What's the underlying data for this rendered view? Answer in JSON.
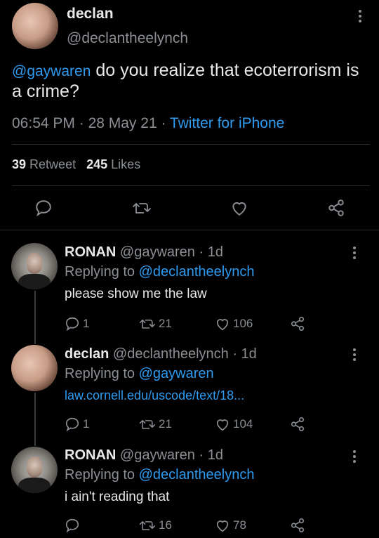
{
  "main_tweet": {
    "display_name": "declan",
    "handle": "@declantheelynch",
    "mention": "@gaywaren",
    "text_line1": " do you realize that ecoterrorism is",
    "text_line2": "a crime?",
    "time": "06:54 PM",
    "sep1": " · ",
    "date": "28 May 21",
    "sep2": " · ",
    "client": "Twitter for iPhone",
    "retweet_count": "39",
    "retweet_label": "Retweet",
    "like_count": "245",
    "like_label": "Likes"
  },
  "replies": [
    {
      "display_name": "RONAN",
      "handle_time": "@gaywaren · 1d",
      "replying_prefix": "Replying to ",
      "replying_to": "@declantheelynch",
      "text": "please show me the law",
      "reply_count": "1",
      "retweet_count": "21",
      "like_count": "106"
    },
    {
      "display_name": "declan",
      "handle_time": "@declantheelynch · 1d",
      "replying_prefix": "Replying to ",
      "replying_to": "@gaywaren",
      "link": "law.cornell.edu/uscode/text/18...",
      "reply_count": "1",
      "retweet_count": "21",
      "like_count": "104"
    },
    {
      "display_name": "RONAN",
      "handle_time": "@gaywaren · 1d",
      "replying_prefix": "Replying to ",
      "replying_to": "@declantheelynch",
      "text": "i ain't reading that",
      "reply_count": "",
      "retweet_count": "16",
      "like_count": "78"
    }
  ],
  "icons": [
    "reply-icon",
    "retweet-icon",
    "like-icon",
    "share-icon",
    "more-icon"
  ],
  "colors": {
    "background": "#000000",
    "text": "#e7e9ea",
    "secondary": "#8b8f94",
    "link": "#2f9bf0"
  }
}
